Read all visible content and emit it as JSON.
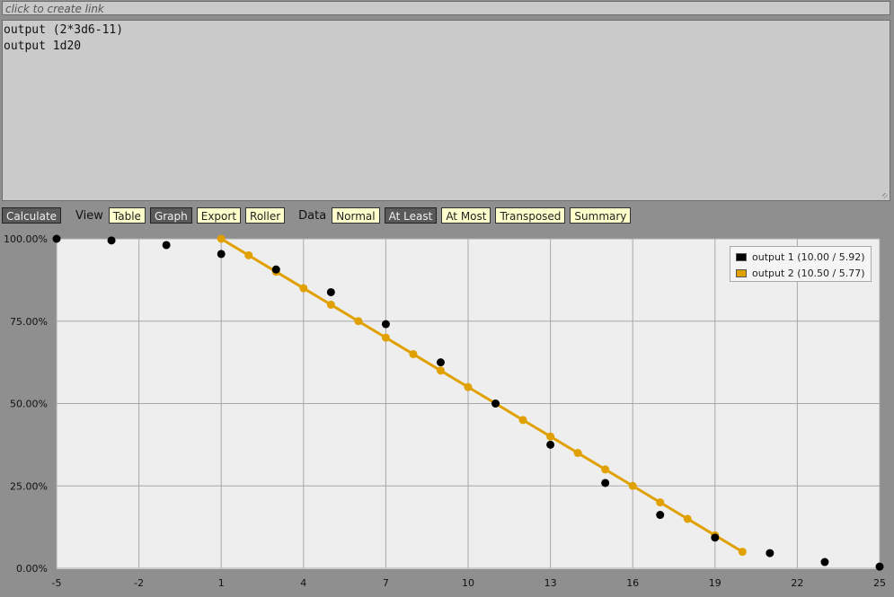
{
  "link_bar": {
    "placeholder": "click to create link"
  },
  "code": {
    "lines": [
      "output (2*3d6-11)",
      "output 1d20"
    ]
  },
  "toolbar": {
    "calculate": "Calculate",
    "view_label": "View",
    "view_buttons": [
      {
        "label": "Table",
        "active": false
      },
      {
        "label": "Graph",
        "active": true
      },
      {
        "label": "Export",
        "active": false
      },
      {
        "label": "Roller",
        "active": false
      }
    ],
    "data_label": "Data",
    "data_buttons": [
      {
        "label": "Normal",
        "active": false
      },
      {
        "label": "At Least",
        "active": true
      },
      {
        "label": "At Most",
        "active": false
      },
      {
        "label": "Transposed",
        "active": false
      },
      {
        "label": "Summary",
        "active": false
      }
    ]
  },
  "colors": {
    "series1": "#000000",
    "series2": "#e0a000",
    "plot_bg": "#eeeeee",
    "grid": "#a8a8a8"
  },
  "chart_data": {
    "type": "line",
    "xlim": [
      -5,
      25
    ],
    "ylim": [
      0,
      100
    ],
    "x_ticks": [
      "-5",
      "-2",
      "1",
      "4",
      "7",
      "10",
      "13",
      "16",
      "19",
      "22",
      "25"
    ],
    "y_ticks": [
      "0.00%",
      "25.00%",
      "50.00%",
      "75.00%",
      "100.00%"
    ],
    "grid": true,
    "legend": "top-right",
    "series": [
      {
        "name": "output 1 (10.00 / 5.92)",
        "line": false,
        "x": [
          -5,
          -3,
          -1,
          1,
          3,
          5,
          7,
          9,
          11,
          13,
          15,
          17,
          19,
          21,
          23,
          25
        ],
        "y": [
          100,
          99.5,
          98.1,
          95.4,
          90.7,
          83.8,
          74.1,
          62.5,
          50.0,
          37.5,
          25.9,
          16.2,
          9.3,
          4.6,
          1.9,
          0.5
        ]
      },
      {
        "name": "output 2 (10.50 / 5.77)",
        "line": true,
        "x": [
          1,
          2,
          3,
          4,
          5,
          6,
          7,
          8,
          9,
          10,
          11,
          12,
          13,
          14,
          15,
          16,
          17,
          18,
          19,
          20
        ],
        "y": [
          100,
          95,
          90,
          85,
          80,
          75,
          70,
          65,
          60,
          55,
          50,
          45,
          40,
          35,
          30,
          25,
          20,
          15,
          10,
          5
        ]
      }
    ]
  }
}
